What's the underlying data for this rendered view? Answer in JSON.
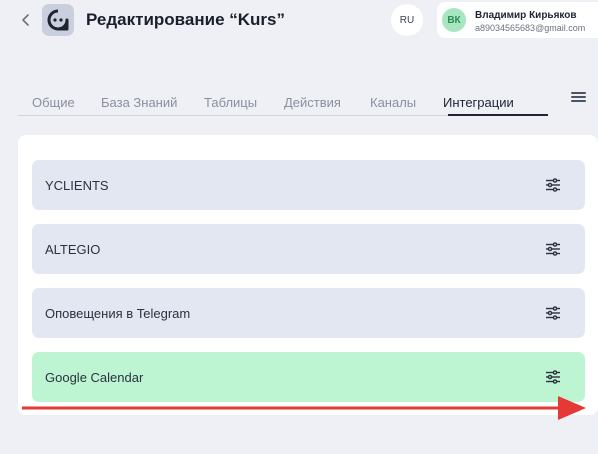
{
  "header": {
    "back_icon": "chevron-left-icon",
    "logo_icon": "bot-face-icon",
    "title": "Редактирование “Kurs”",
    "language": "RU",
    "user": {
      "initials": "ВК",
      "name": "Владимир Кирьяков",
      "email": "a89034565683@gmail.com"
    }
  },
  "tabs": [
    {
      "label": "Общие",
      "active": false
    },
    {
      "label": "База Знаний",
      "active": false
    },
    {
      "label": "Таблицы",
      "active": false
    },
    {
      "label": "Действия",
      "active": false
    },
    {
      "label": "Каналы",
      "active": false
    },
    {
      "label": "Интеграции",
      "active": true
    }
  ],
  "menu_icon": "hamburger-menu-icon",
  "integrations": [
    {
      "label": "YCLIENTS",
      "icon": "sliders-icon",
      "highlighted": false
    },
    {
      "label": "ALTEGIO",
      "icon": "sliders-icon",
      "highlighted": false
    },
    {
      "label": "Оповещения в Telegram",
      "icon": "sliders-icon",
      "highlighted": false
    },
    {
      "label": "Google Calendar",
      "icon": "sliders-icon",
      "highlighted": true
    }
  ],
  "colors": {
    "background": "#eef0f5",
    "card": "#e3e7f2",
    "card_highlight": "#bdf5d3",
    "avatar_bg": "#a8e6c0",
    "annotation_arrow": "#e53935"
  }
}
